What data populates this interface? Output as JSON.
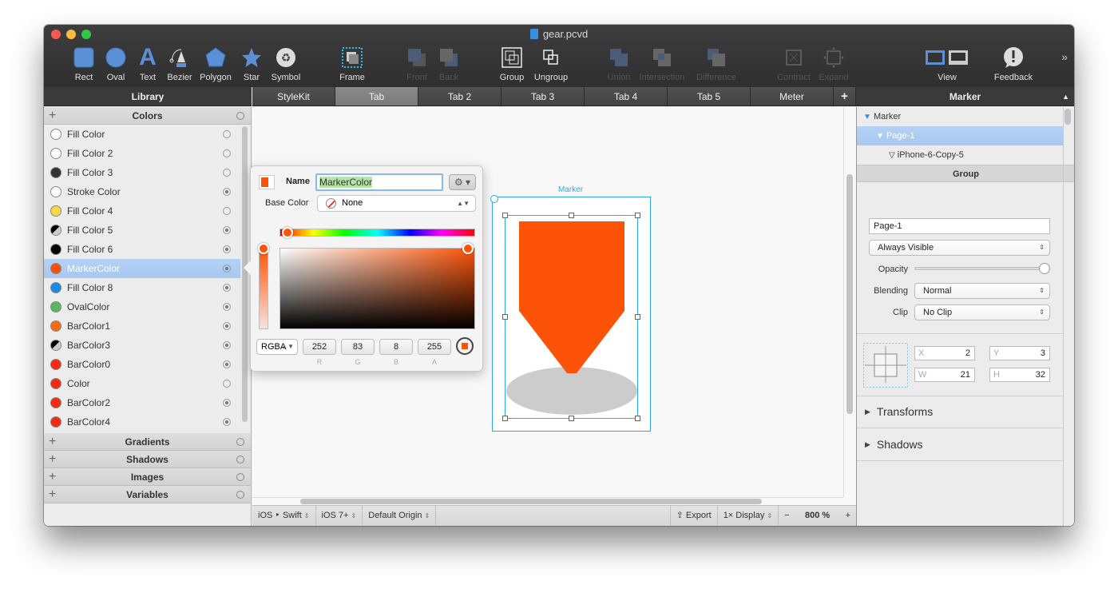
{
  "window": {
    "title": "gear.pcvd"
  },
  "toolbar": {
    "items": [
      {
        "label": "Rect",
        "icon": "rect-icon",
        "enabled": true
      },
      {
        "label": "Oval",
        "icon": "oval-icon",
        "enabled": true
      },
      {
        "label": "Text",
        "icon": "text-icon",
        "enabled": true
      },
      {
        "label": "Bezier",
        "icon": "bezier-pen-icon",
        "enabled": true
      },
      {
        "label": "Polygon",
        "icon": "polygon-icon",
        "enabled": true
      },
      {
        "label": "Star",
        "icon": "star-icon",
        "enabled": true
      },
      {
        "label": "Symbol",
        "icon": "symbol-icon",
        "enabled": true
      },
      {
        "label": "Frame",
        "icon": "frame-icon",
        "enabled": true
      },
      {
        "label": "Front",
        "icon": "bring-front-icon",
        "enabled": false
      },
      {
        "label": "Back",
        "icon": "send-back-icon",
        "enabled": false
      },
      {
        "label": "Group",
        "icon": "group-icon",
        "enabled": true
      },
      {
        "label": "Ungroup",
        "icon": "ungroup-icon",
        "enabled": true
      },
      {
        "label": "Union",
        "icon": "union-icon",
        "enabled": false
      },
      {
        "label": "Intersection",
        "icon": "intersection-icon",
        "enabled": false
      },
      {
        "label": "Difference",
        "icon": "difference-icon",
        "enabled": false
      },
      {
        "label": "Contract",
        "icon": "contract-icon",
        "enabled": false
      },
      {
        "label": "Expand",
        "icon": "expand-icon",
        "enabled": false
      },
      {
        "label": "View",
        "icon": "view-icon",
        "enabled": true
      },
      {
        "label": "Feedback",
        "icon": "feedback-icon",
        "enabled": true
      }
    ],
    "overflow": "»"
  },
  "library": {
    "title": "Library",
    "sections": {
      "colors": "Colors",
      "gradients": "Gradients",
      "shadows": "Shadows",
      "images": "Images",
      "variables": "Variables"
    },
    "colors": [
      {
        "name": "Fill Color",
        "swatch": "#ffffff",
        "used": false
      },
      {
        "name": "Fill Color 2",
        "swatch": "#ffffff",
        "used": false
      },
      {
        "name": "Fill Color 3",
        "swatch": "#333333",
        "used": false
      },
      {
        "name": "Stroke Color",
        "swatch": "#ffffff",
        "used": true
      },
      {
        "name": "Fill Color 4",
        "swatch": "#fbd84a",
        "used": false
      },
      {
        "name": "Fill Color 5",
        "swatch": "half",
        "used": true
      },
      {
        "name": "Fill Color 6",
        "swatch": "#000000",
        "used": true
      },
      {
        "name": "MarkerColor",
        "swatch": "#fc5308",
        "used": true,
        "selected": true
      },
      {
        "name": "Fill Color 8",
        "swatch": "#1a8ae6",
        "used": true
      },
      {
        "name": "OvalColor",
        "swatch": "#5cb85c",
        "used": true
      },
      {
        "name": "BarColor1",
        "swatch": "#fc6a10",
        "used": true
      },
      {
        "name": "BarColor3",
        "swatch": "half",
        "used": true
      },
      {
        "name": "BarColor0",
        "swatch": "#f52b14",
        "used": true
      },
      {
        "name": "Color",
        "swatch": "#f52b14",
        "used": false
      },
      {
        "name": "BarColor2",
        "swatch": "#f52b14",
        "used": true
      },
      {
        "name": "BarColor4",
        "swatch": "#f52b14",
        "used": true
      }
    ]
  },
  "tabs": [
    {
      "label": "StyleKit",
      "active": false
    },
    {
      "label": "Tab",
      "active": true
    },
    {
      "label": "Tab 2",
      "active": false
    },
    {
      "label": "Tab 3",
      "active": false
    },
    {
      "label": "Tab 4",
      "active": false
    },
    {
      "label": "Tab 5",
      "active": false
    },
    {
      "label": "Meter",
      "active": false
    }
  ],
  "tab_add": "+",
  "canvas": {
    "frame_label": "Marker",
    "marker_color": "#fc5308",
    "shadow_color": "#cccccc"
  },
  "color_popover": {
    "name_label": "Name",
    "name_value": "MarkerColor",
    "gear": "⚙ ▾",
    "base_color_label": "Base Color",
    "base_color_value": "None",
    "mode": "RGBA",
    "hue_position": 0.04,
    "channels": [
      {
        "label": "R",
        "value": "252"
      },
      {
        "label": "G",
        "value": "83"
      },
      {
        "label": "B",
        "value": "8"
      },
      {
        "label": "A",
        "value": "255"
      }
    ],
    "color": "#fc5308"
  },
  "statusbar": {
    "language": "iOS ‣ Swift",
    "target": "iOS 7+",
    "origin": "Default Origin",
    "export": "Export",
    "display": "1× Display",
    "zoom_minus": "−",
    "zoom": "800 %",
    "zoom_plus": "+"
  },
  "inspector": {
    "title": "Marker",
    "tree": [
      {
        "label": "Marker",
        "level": 0,
        "selected": false
      },
      {
        "label": "Page-1",
        "level": 1,
        "selected": true
      },
      {
        "label": "iPhone-6-Copy-5",
        "level": 2,
        "selected": false
      }
    ],
    "group_title": "Group",
    "name_value": "Page-1",
    "visibility": "Always Visible",
    "opacity_label": "Opacity",
    "opacity": 1.0,
    "blending_label": "Blending",
    "blending": "Normal",
    "clip_label": "Clip",
    "clip": "No Clip",
    "x_label": "X",
    "x": "2",
    "y_label": "Y",
    "y": "3",
    "w_label": "W",
    "w": "21",
    "h_label": "H",
    "h": "32",
    "transforms": "Transforms",
    "shadows": "Shadows"
  }
}
